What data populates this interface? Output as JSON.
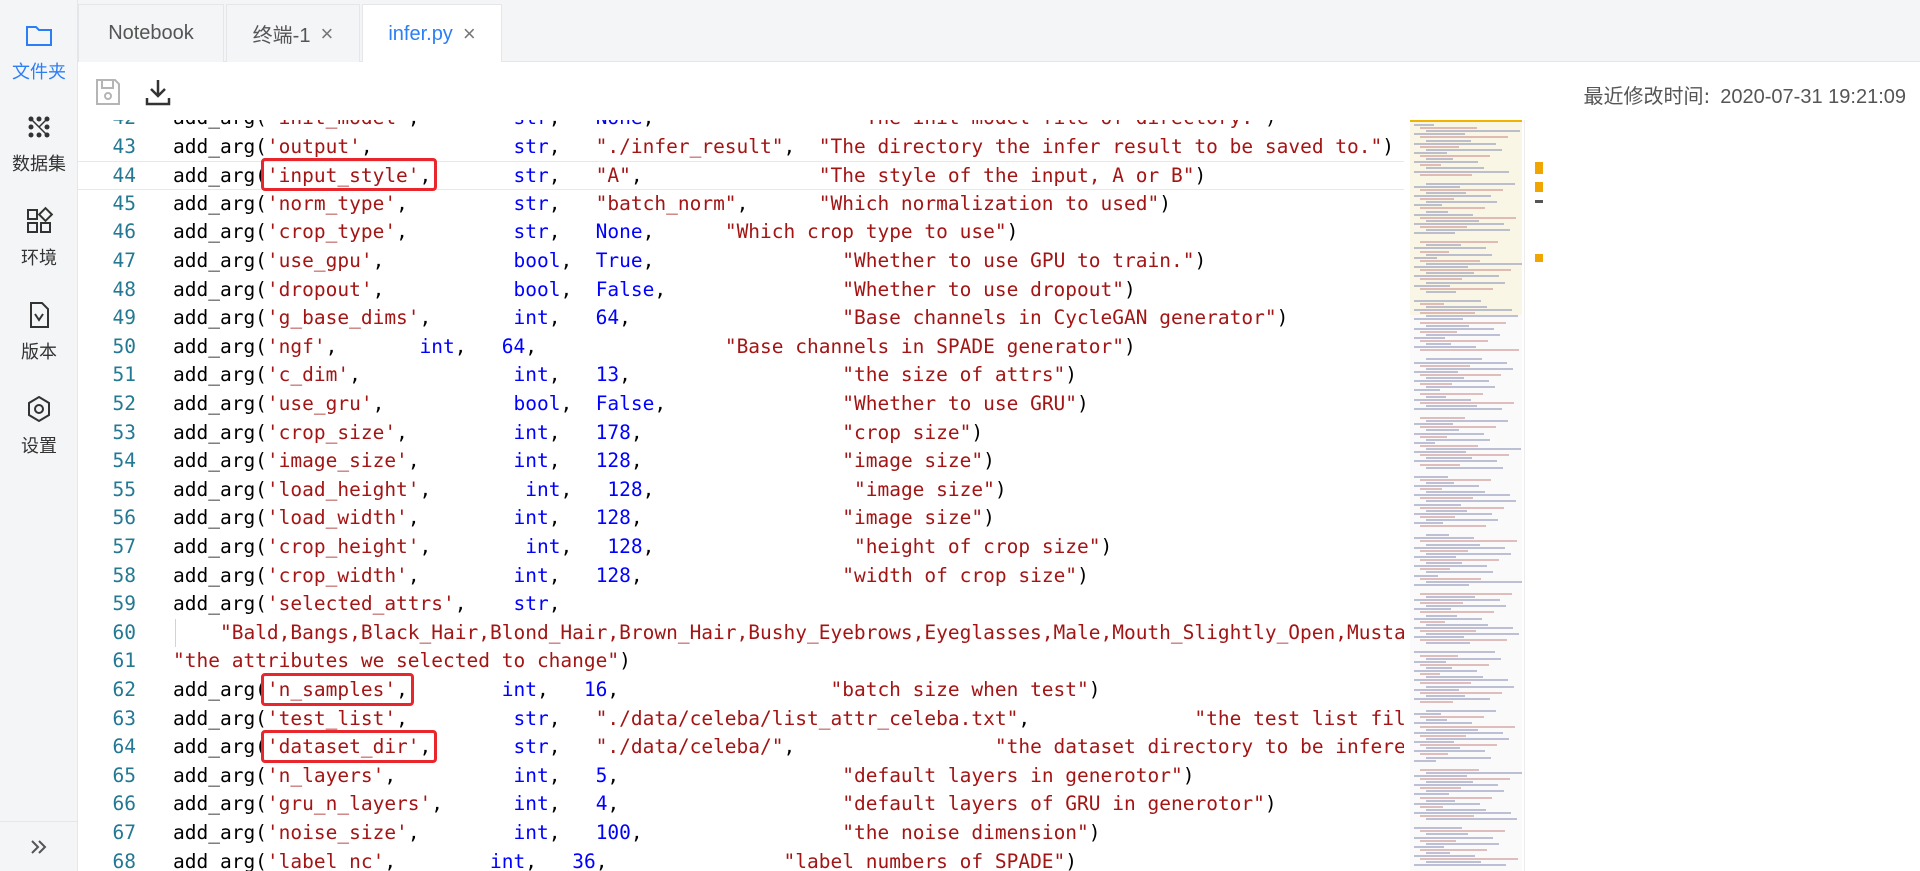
{
  "sidebar": {
    "items": [
      {
        "label": "文件夹",
        "icon": "folder-icon",
        "active": true
      },
      {
        "label": "数据集",
        "icon": "dataset-icon",
        "active": false
      },
      {
        "label": "环境",
        "icon": "grid-icon",
        "active": false
      },
      {
        "label": "版本",
        "icon": "version-icon",
        "active": false
      },
      {
        "label": "设置",
        "icon": "gear-icon",
        "active": false
      }
    ],
    "expand_icon": "double-chevron-right-icon"
  },
  "tabs": [
    {
      "label": "Notebook",
      "closable": false,
      "active": false
    },
    {
      "label": "终端-1",
      "closable": true,
      "active": false
    },
    {
      "label": "infer.py",
      "closable": true,
      "active": true
    }
  ],
  "toolbar": {
    "save_icon": "save-icon",
    "download_icon": "download-icon",
    "modified_label": "最近修改时间:",
    "modified_time": "2020-07-31 19:21:09"
  },
  "colors": {
    "accent": "#2b7ef6",
    "highlight_box": "#e8262b",
    "line_number": "#237893",
    "string": "#a31515",
    "keyword": "#0000ff"
  },
  "editor": {
    "lines": [
      {
        "n": "42",
        "tokens": [
          [
            "fn",
            "add_arg("
          ],
          [
            "str",
            "'init_model'"
          ],
          [
            "fn",
            ",        "
          ],
          [
            "kw",
            "str"
          ],
          [
            "fn",
            ",   "
          ],
          [
            "kw",
            "None"
          ],
          [
            "fn",
            ",                 "
          ],
          [
            "str",
            "\"The init model file of directory.\""
          ],
          [
            "fn",
            ")"
          ]
        ]
      },
      {
        "n": "43",
        "tokens": [
          [
            "fn",
            "add_arg("
          ],
          [
            "str",
            "'output'"
          ],
          [
            "fn",
            ",            "
          ],
          [
            "kw",
            "str"
          ],
          [
            "fn",
            ",   "
          ],
          [
            "str",
            "\"./infer_result\""
          ],
          [
            "fn",
            ",  "
          ],
          [
            "str",
            "\"The directory the infer result to be saved to.\""
          ],
          [
            "fn",
            ")"
          ]
        ]
      },
      {
        "n": "44",
        "tokens": [
          [
            "fn",
            "add_arg("
          ],
          [
            "str",
            "'input_style'"
          ],
          [
            "fn",
            ",       "
          ],
          [
            "kw",
            "str"
          ],
          [
            "fn",
            ",   "
          ],
          [
            "str",
            "\"A\""
          ],
          [
            "fn",
            ",               "
          ],
          [
            "str",
            "\"The style of the input, A or B\""
          ],
          [
            "fn",
            ")"
          ]
        ]
      },
      {
        "n": "45",
        "tokens": [
          [
            "fn",
            "add_arg("
          ],
          [
            "str",
            "'norm_type'"
          ],
          [
            "fn",
            ",         "
          ],
          [
            "kw",
            "str"
          ],
          [
            "fn",
            ",   "
          ],
          [
            "str",
            "\"batch_norm\""
          ],
          [
            "fn",
            ",      "
          ],
          [
            "str",
            "\"Which normalization to used\""
          ],
          [
            "fn",
            ")"
          ]
        ]
      },
      {
        "n": "46",
        "tokens": [
          [
            "fn",
            "add_arg("
          ],
          [
            "str",
            "'crop_type'"
          ],
          [
            "fn",
            ",         "
          ],
          [
            "kw",
            "str"
          ],
          [
            "fn",
            ",   "
          ],
          [
            "kw",
            "None"
          ],
          [
            "fn",
            ",      "
          ],
          [
            "str",
            "\"Which crop type to use\""
          ],
          [
            "fn",
            ")"
          ]
        ]
      },
      {
        "n": "47",
        "tokens": [
          [
            "fn",
            "add_arg("
          ],
          [
            "str",
            "'use_gpu'"
          ],
          [
            "fn",
            ",           "
          ],
          [
            "kw",
            "bool"
          ],
          [
            "fn",
            ",  "
          ],
          [
            "kw",
            "True"
          ],
          [
            "fn",
            ",                "
          ],
          [
            "str",
            "\"Whether to use GPU to train.\""
          ],
          [
            "fn",
            ")"
          ]
        ]
      },
      {
        "n": "48",
        "tokens": [
          [
            "fn",
            "add_arg("
          ],
          [
            "str",
            "'dropout'"
          ],
          [
            "fn",
            ",           "
          ],
          [
            "kw",
            "bool"
          ],
          [
            "fn",
            ",  "
          ],
          [
            "kw",
            "False"
          ],
          [
            "fn",
            ",               "
          ],
          [
            "str",
            "\"Whether to use dropout\""
          ],
          [
            "fn",
            ")"
          ]
        ]
      },
      {
        "n": "49",
        "tokens": [
          [
            "fn",
            "add_arg("
          ],
          [
            "str",
            "'g_base_dims'"
          ],
          [
            "fn",
            ",       "
          ],
          [
            "kw",
            "int"
          ],
          [
            "fn",
            ",   "
          ],
          [
            "kw",
            "64"
          ],
          [
            "fn",
            ",                  "
          ],
          [
            "str",
            "\"Base channels in CycleGAN generator\""
          ],
          [
            "fn",
            ")"
          ]
        ]
      },
      {
        "n": "50",
        "tokens": [
          [
            "fn",
            "add_arg("
          ],
          [
            "str",
            "'ngf'"
          ],
          [
            "fn",
            ",       "
          ],
          [
            "kw",
            "int"
          ],
          [
            "fn",
            ",   "
          ],
          [
            "kw",
            "64"
          ],
          [
            "fn",
            ",                "
          ],
          [
            "str",
            "\"Base channels in SPADE generator\""
          ],
          [
            "fn",
            ")"
          ]
        ]
      },
      {
        "n": "51",
        "tokens": [
          [
            "fn",
            "add_arg("
          ],
          [
            "str",
            "'c_dim'"
          ],
          [
            "fn",
            ",             "
          ],
          [
            "kw",
            "int"
          ],
          [
            "fn",
            ",   "
          ],
          [
            "kw",
            "13"
          ],
          [
            "fn",
            ",                  "
          ],
          [
            "str",
            "\"the size of attrs\""
          ],
          [
            "fn",
            ")"
          ]
        ]
      },
      {
        "n": "52",
        "tokens": [
          [
            "fn",
            "add_arg("
          ],
          [
            "str",
            "'use_gru'"
          ],
          [
            "fn",
            ",           "
          ],
          [
            "kw",
            "bool"
          ],
          [
            "fn",
            ",  "
          ],
          [
            "kw",
            "False"
          ],
          [
            "fn",
            ",               "
          ],
          [
            "str",
            "\"Whether to use GRU\""
          ],
          [
            "fn",
            ")"
          ]
        ]
      },
      {
        "n": "53",
        "tokens": [
          [
            "fn",
            "add_arg("
          ],
          [
            "str",
            "'crop_size'"
          ],
          [
            "fn",
            ",         "
          ],
          [
            "kw",
            "int"
          ],
          [
            "fn",
            ",   "
          ],
          [
            "kw",
            "178"
          ],
          [
            "fn",
            ",                 "
          ],
          [
            "str",
            "\"crop size\""
          ],
          [
            "fn",
            ")"
          ]
        ]
      },
      {
        "n": "54",
        "tokens": [
          [
            "fn",
            "add_arg("
          ],
          [
            "str",
            "'image_size'"
          ],
          [
            "fn",
            ",        "
          ],
          [
            "kw",
            "int"
          ],
          [
            "fn",
            ",   "
          ],
          [
            "kw",
            "128"
          ],
          [
            "fn",
            ",                 "
          ],
          [
            "str",
            "\"image size\""
          ],
          [
            "fn",
            ")"
          ]
        ]
      },
      {
        "n": "55",
        "tokens": [
          [
            "fn",
            "add_arg("
          ],
          [
            "str",
            "'load_height'"
          ],
          [
            "fn",
            ",        "
          ],
          [
            "kw",
            "int"
          ],
          [
            "fn",
            ",   "
          ],
          [
            "kw",
            "128"
          ],
          [
            "fn",
            ",                 "
          ],
          [
            "str",
            "\"image size\""
          ],
          [
            "fn",
            ")"
          ]
        ]
      },
      {
        "n": "56",
        "tokens": [
          [
            "fn",
            "add_arg("
          ],
          [
            "str",
            "'load_width'"
          ],
          [
            "fn",
            ",        "
          ],
          [
            "kw",
            "int"
          ],
          [
            "fn",
            ",   "
          ],
          [
            "kw",
            "128"
          ],
          [
            "fn",
            ",                 "
          ],
          [
            "str",
            "\"image size\""
          ],
          [
            "fn",
            ")"
          ]
        ]
      },
      {
        "n": "57",
        "tokens": [
          [
            "fn",
            "add_arg("
          ],
          [
            "str",
            "'crop_height'"
          ],
          [
            "fn",
            ",        "
          ],
          [
            "kw",
            "int"
          ],
          [
            "fn",
            ",   "
          ],
          [
            "kw",
            "128"
          ],
          [
            "fn",
            ",                 "
          ],
          [
            "str",
            "\"height of crop size\""
          ],
          [
            "fn",
            ")"
          ]
        ]
      },
      {
        "n": "58",
        "tokens": [
          [
            "fn",
            "add_arg("
          ],
          [
            "str",
            "'crop_width'"
          ],
          [
            "fn",
            ",        "
          ],
          [
            "kw",
            "int"
          ],
          [
            "fn",
            ",   "
          ],
          [
            "kw",
            "128"
          ],
          [
            "fn",
            ",                 "
          ],
          [
            "str",
            "\"width of crop size\""
          ],
          [
            "fn",
            ")"
          ]
        ]
      },
      {
        "n": "59",
        "tokens": [
          [
            "fn",
            "add_arg("
          ],
          [
            "str",
            "'selected_attrs'"
          ],
          [
            "fn",
            ",    "
          ],
          [
            "kw",
            "str"
          ],
          [
            "fn",
            ","
          ]
        ]
      },
      {
        "n": "60",
        "tokens": [
          [
            "fn",
            "    "
          ],
          [
            "str",
            "\"Bald,Bangs,Black_Hair,Blond_Hair,Brown_Hair,Bushy_Eyebrows,Eyeglasses,Male,Mouth_Slightly_Open,Mustach"
          ]
        ]
      },
      {
        "n": "61",
        "tokens": [
          [
            "str",
            "\"the attributes we selected to change\""
          ],
          [
            "fn",
            ")"
          ]
        ]
      },
      {
        "n": "62",
        "tokens": [
          [
            "fn",
            "add_arg("
          ],
          [
            "str",
            "'n_samples'"
          ],
          [
            "fn",
            ",        "
          ],
          [
            "kw",
            "int"
          ],
          [
            "fn",
            ",   "
          ],
          [
            "kw",
            "16"
          ],
          [
            "fn",
            ",                  "
          ],
          [
            "str",
            "\"batch size when test\""
          ],
          [
            "fn",
            ")"
          ]
        ]
      },
      {
        "n": "63",
        "tokens": [
          [
            "fn",
            "add_arg("
          ],
          [
            "str",
            "'test_list'"
          ],
          [
            "fn",
            ",         "
          ],
          [
            "kw",
            "str"
          ],
          [
            "fn",
            ",   "
          ],
          [
            "str",
            "\"./data/celeba/list_attr_celeba.txt\""
          ],
          [
            "fn",
            ",              "
          ],
          [
            "str",
            "\"the test list fil"
          ]
        ]
      },
      {
        "n": "64",
        "tokens": [
          [
            "fn",
            "add_arg("
          ],
          [
            "str",
            "'dataset_dir'"
          ],
          [
            "fn",
            ",       "
          ],
          [
            "kw",
            "str"
          ],
          [
            "fn",
            ",   "
          ],
          [
            "str",
            "\"./data/celeba/\""
          ],
          [
            "fn",
            ",                 "
          ],
          [
            "str",
            "\"the dataset directory to be infered\""
          ],
          [
            "fn",
            ")"
          ]
        ]
      },
      {
        "n": "65",
        "tokens": [
          [
            "fn",
            "add_arg("
          ],
          [
            "str",
            "'n_layers'"
          ],
          [
            "fn",
            ",          "
          ],
          [
            "kw",
            "int"
          ],
          [
            "fn",
            ",   "
          ],
          [
            "kw",
            "5"
          ],
          [
            "fn",
            ",                   "
          ],
          [
            "str",
            "\"default layers in generotor\""
          ],
          [
            "fn",
            ")"
          ]
        ]
      },
      {
        "n": "66",
        "tokens": [
          [
            "fn",
            "add_arg("
          ],
          [
            "str",
            "'gru_n_layers'"
          ],
          [
            "fn",
            ",      "
          ],
          [
            "kw",
            "int"
          ],
          [
            "fn",
            ",   "
          ],
          [
            "kw",
            "4"
          ],
          [
            "fn",
            ",                   "
          ],
          [
            "str",
            "\"default layers of GRU in generotor\""
          ],
          [
            "fn",
            ")"
          ]
        ]
      },
      {
        "n": "67",
        "tokens": [
          [
            "fn",
            "add_arg("
          ],
          [
            "str",
            "'noise_size'"
          ],
          [
            "fn",
            ",        "
          ],
          [
            "kw",
            "int"
          ],
          [
            "fn",
            ",   "
          ],
          [
            "kw",
            "100"
          ],
          [
            "fn",
            ",                 "
          ],
          [
            "str",
            "\"the noise dimension\""
          ],
          [
            "fn",
            ")"
          ]
        ]
      },
      {
        "n": "68",
        "tokens": [
          [
            "fn",
            "add_arg("
          ],
          [
            "str",
            "'label_nc'"
          ],
          [
            "fn",
            ",        "
          ],
          [
            "kw",
            "int"
          ],
          [
            "fn",
            ",   "
          ],
          [
            "kw",
            "36"
          ],
          [
            "fn",
            ",               "
          ],
          [
            "str",
            "\"label numbers of SPADE\""
          ],
          [
            "fn",
            ")"
          ]
        ]
      }
    ]
  }
}
